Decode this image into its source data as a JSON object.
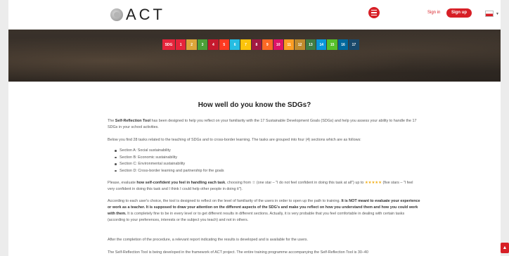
{
  "header": {
    "logo_text": "ACT",
    "signin_label": "Sign in",
    "signup_label": "Sign up",
    "language_flag": "flag-icon"
  },
  "sdg_icons": {
    "logo_label": "SDG",
    "goals": [
      {
        "label": "1",
        "color": "#e5243b"
      },
      {
        "label": "2",
        "color": "#dda63a"
      },
      {
        "label": "3",
        "color": "#4c9f38"
      },
      {
        "label": "4",
        "color": "#c5192d"
      },
      {
        "label": "5",
        "color": "#ff3a21"
      },
      {
        "label": "6",
        "color": "#26bde2"
      },
      {
        "label": "7",
        "color": "#fcc30b"
      },
      {
        "label": "8",
        "color": "#a21942"
      },
      {
        "label": "9",
        "color": "#fd6925"
      },
      {
        "label": "10",
        "color": "#dd1367"
      },
      {
        "label": "11",
        "color": "#fd9d24"
      },
      {
        "label": "12",
        "color": "#bf8b2e"
      },
      {
        "label": "13",
        "color": "#3f7e44"
      },
      {
        "label": "14",
        "color": "#0a97d9"
      },
      {
        "label": "15",
        "color": "#56c02b"
      },
      {
        "label": "16",
        "color": "#00689d"
      },
      {
        "label": "17",
        "color": "#19486a"
      }
    ]
  },
  "content": {
    "title": "How well do you know the SDGs?",
    "p1_tool": "Self-Reflection Tool",
    "p1_rest": " has been designed to help you reflect on your familiarity with the 17 Sustainable Development Goals (SDGs) and help you assess your ability to handle the 17 SDGs in your school activities.",
    "p2": "Below you find 28 tasks related to the teaching of SDGs and to cross-border learning. The tasks are grouped into four (4) sections which are as follows:",
    "sections": [
      "Section A: Social sustainability",
      "Section B: Economic sustainability",
      "Section C: Environmental sustainability",
      "Section D: Cross-border learning and partnership for the goals"
    ],
    "p3_a": "Please, evaluate ",
    "p3_b": "how self-confident you feel in handling each task",
    "p3_c": ", choosing from ☆ (one star – \"I do not feel confident in doing this task at all\") up to ",
    "p3_stars": "★★★★★",
    "p3_d": " (five stars – \"I feel very confident in doing this task and I think I could help other people in doing it\").",
    "p4_a": "According to each user's choice, the tool is designed to reflect on the level of familiarity of the users in order to open up the path to training. ",
    "p4_b": "It is NOT meant to evaluate your experience or work as a teacher. It is supposed to draw your attention on the different aspects of the SDG's and make you reflect on how you understand them and how you could work with them.",
    "p4_c": " It is completely fine to be in every level or to get different results in different sections. Actually, it is very probable that you feel comfortable in dealing with certain tasks (according to your preferences, interests or the subject you teach) and not in others.",
    "p5": "After the completion of the procedure, a relevant report indicating the results is developed and is available for the users.",
    "p6": "The Self-Reflection Tool is being developed in the framework of ACT project. The entire training programme accompanying the Self-Reflection Tool is 30–40"
  }
}
